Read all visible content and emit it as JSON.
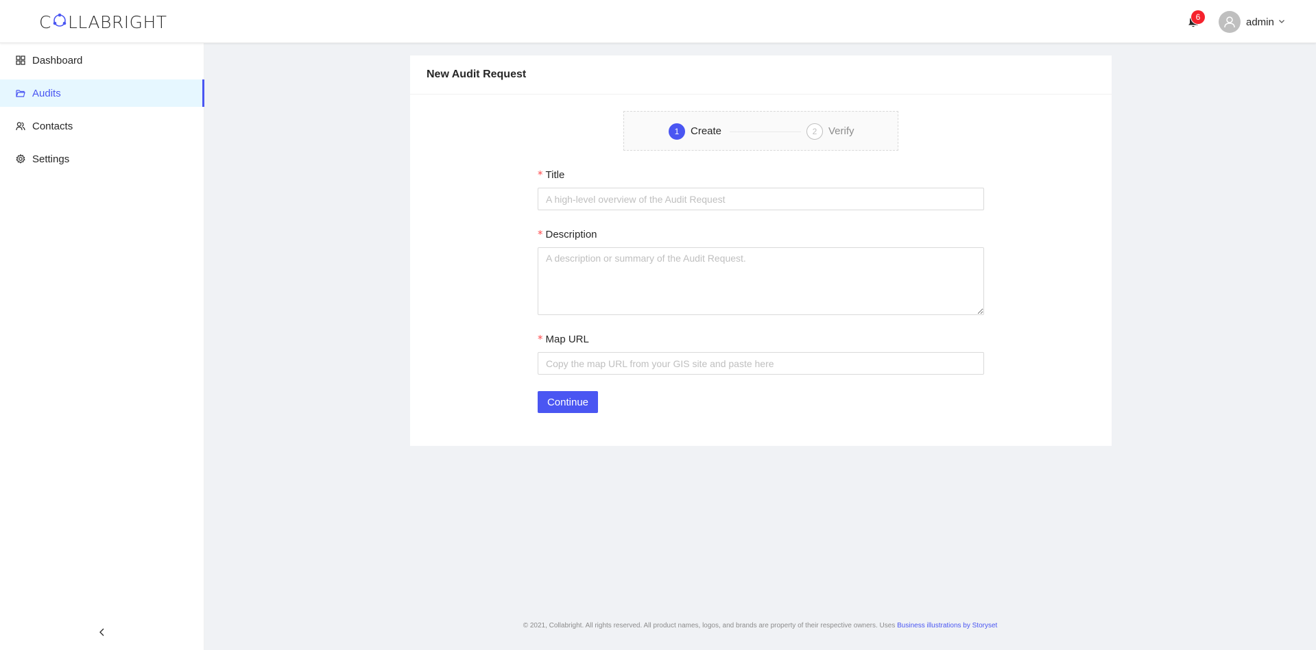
{
  "header": {
    "logo_text": "COLLABRIGHT",
    "notification_count": "6",
    "username": "admin",
    "icons": [
      "collabright-logo",
      "bell-icon",
      "user-avatar-icon",
      "chevron-down-icon"
    ]
  },
  "sidebar": {
    "items": [
      {
        "label": "Dashboard",
        "icon": "dashboard-icon",
        "active": false
      },
      {
        "label": "Audits",
        "icon": "folder-icon",
        "active": true
      },
      {
        "label": "Contacts",
        "icon": "contacts-icon",
        "active": false
      },
      {
        "label": "Settings",
        "icon": "gear-icon",
        "active": false
      }
    ],
    "collapse_icon": "chevron-left-icon"
  },
  "card": {
    "title": "New Audit Request",
    "steps": [
      {
        "number": "1",
        "label": "Create",
        "status": "current"
      },
      {
        "number": "2",
        "label": "Verify",
        "status": "wait"
      }
    ],
    "form": {
      "required_mark": "*",
      "title": {
        "label": "Title",
        "placeholder": "A high-level overview of the Audit Request",
        "value": ""
      },
      "description": {
        "label": "Description",
        "placeholder": "A description or summary of the Audit Request.",
        "value": ""
      },
      "map_url": {
        "label": "Map URL",
        "placeholder": "Copy the map URL from your GIS site and paste here",
        "value": ""
      },
      "submit_label": "Continue"
    }
  },
  "footer": {
    "text": "© 2021, Collabright. All rights reserved. All product names, logos, and brands are property of their respective owners. Uses ",
    "link_text": "Business illustrations by Storyset"
  },
  "colors": {
    "primary": "#4a56f2",
    "badge": "#f5222d",
    "required": "#ff4d4f",
    "active_bg": "#e6f7ff",
    "page_bg": "#f0f2f5"
  }
}
